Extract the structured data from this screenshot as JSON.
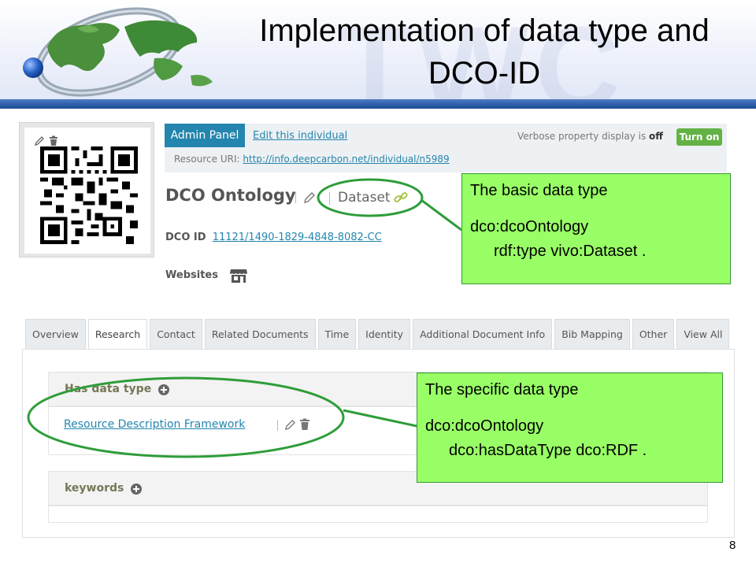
{
  "slide": {
    "title_line1": "Implementation of data type and",
    "title_line2": "DCO-ID",
    "watermark": "TWC",
    "page_number": "8"
  },
  "admin": {
    "panel_label": "Admin Panel",
    "edit_label": "Edit this individual",
    "verbose_prefix": "Verbose property display is",
    "verbose_state": "off",
    "turn_on_label": "Turn on",
    "resource_uri_label": "Resource URI:",
    "resource_uri": "http://info.deepcarbon.net/individual/n5989"
  },
  "profile": {
    "name": "DCO Ontology",
    "type_label": "Dataset",
    "dcoid_label": "DCO ID",
    "dcoid_value": "11121/1490-1829-4848-8082-CC",
    "websites_label": "Websites"
  },
  "tabs": [
    {
      "label": "Overview",
      "active": false
    },
    {
      "label": "Research",
      "active": true
    },
    {
      "label": "Contact",
      "active": false
    },
    {
      "label": "Related Documents",
      "active": false
    },
    {
      "label": "Time",
      "active": false
    },
    {
      "label": "Identity",
      "active": false
    },
    {
      "label": "Additional Document Info",
      "active": false
    },
    {
      "label": "Bib Mapping",
      "active": false
    },
    {
      "label": "Other",
      "active": false
    },
    {
      "label": "View All",
      "active": false
    }
  ],
  "sections": {
    "data_type_title": "Has data type",
    "data_type_value": "Resource Description Framework",
    "keywords_title": "keywords"
  },
  "callouts": {
    "basic": {
      "line1": "The basic data type",
      "line2": "dco:dcoOntology",
      "line3": "rdf:type vivo:Dataset ."
    },
    "specific": {
      "line1": "The specific data type",
      "line2": "dco:dcoOntology",
      "line3": "dco:hasDataType dco:RDF ."
    }
  },
  "colors": {
    "accent_blue": "#2485ae",
    "callout_green": "#99ff66",
    "ellipse_green": "#2e9d3a",
    "turn_on_green": "#62b246",
    "header_bar_blue": "#2d5da8"
  }
}
